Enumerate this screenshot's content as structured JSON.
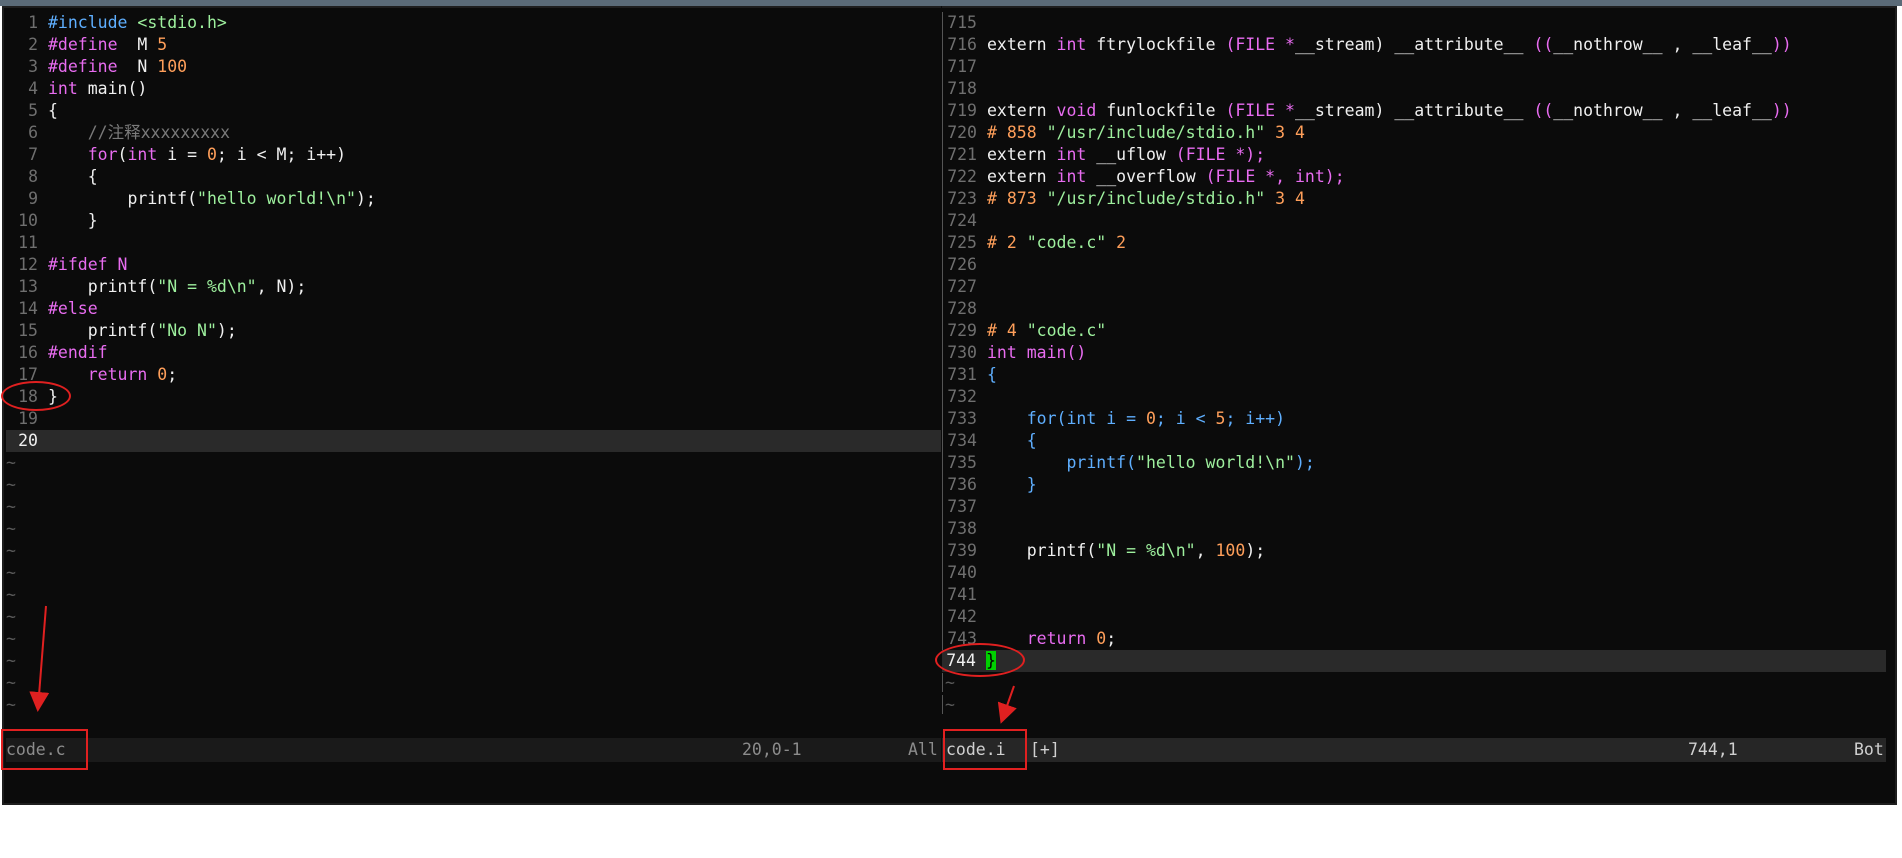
{
  "left_pane": {
    "lines": [
      {
        "n": "1",
        "tokens": [
          [
            "c-pre",
            "#include "
          ],
          [
            "c-str",
            "<stdio.h>"
          ]
        ]
      },
      {
        "n": "2",
        "tokens": [
          [
            "c-def",
            "#define  "
          ],
          [
            "c-ident",
            "M "
          ],
          [
            "c-num",
            "5"
          ]
        ]
      },
      {
        "n": "3",
        "tokens": [
          [
            "c-def",
            "#define  "
          ],
          [
            "c-ident",
            "N "
          ],
          [
            "c-num",
            "100"
          ]
        ]
      },
      {
        "n": "4",
        "tokens": [
          [
            "c-type",
            "int"
          ],
          [
            "c-ident",
            " main()"
          ]
        ]
      },
      {
        "n": "5",
        "tokens": [
          [
            "c-ident",
            "{"
          ]
        ]
      },
      {
        "n": "6",
        "tokens": [
          [
            "c-cmt",
            "    //注释xxxxxxxxx"
          ]
        ]
      },
      {
        "n": "7",
        "tokens": [
          [
            "c-kw",
            "    for"
          ],
          [
            "c-ident",
            "("
          ],
          [
            "c-type",
            "int"
          ],
          [
            "c-ident",
            " i = "
          ],
          [
            "c-num",
            "0"
          ],
          [
            "c-ident",
            "; i < M; i++)"
          ]
        ]
      },
      {
        "n": "8",
        "tokens": [
          [
            "c-ident",
            "    {"
          ]
        ]
      },
      {
        "n": "9",
        "tokens": [
          [
            "c-ident",
            "        printf("
          ],
          [
            "c-str",
            "\"hello world!\\n\""
          ],
          [
            "c-ident",
            ");"
          ]
        ]
      },
      {
        "n": "10",
        "tokens": [
          [
            "c-ident",
            "    }"
          ]
        ]
      },
      {
        "n": "11",
        "tokens": []
      },
      {
        "n": "12",
        "tokens": [
          [
            "c-def",
            "#ifdef N"
          ]
        ]
      },
      {
        "n": "13",
        "tokens": [
          [
            "c-ident",
            "    printf("
          ],
          [
            "c-str",
            "\"N = %d\\n\""
          ],
          [
            "c-ident",
            ", N);"
          ]
        ]
      },
      {
        "n": "14",
        "tokens": [
          [
            "c-def",
            "#else"
          ]
        ]
      },
      {
        "n": "15",
        "tokens": [
          [
            "c-ident",
            "    printf("
          ],
          [
            "c-str",
            "\"No N\""
          ],
          [
            "c-ident",
            ");"
          ]
        ]
      },
      {
        "n": "16",
        "tokens": [
          [
            "c-def",
            "#endif"
          ]
        ]
      },
      {
        "n": "17",
        "tokens": [
          [
            "c-kw",
            "    return "
          ],
          [
            "c-num",
            "0"
          ],
          [
            "c-ident",
            ";"
          ]
        ]
      },
      {
        "n": "18",
        "tokens": [
          [
            "c-ident",
            "}"
          ]
        ]
      },
      {
        "n": "19",
        "tokens": []
      },
      {
        "n": "20",
        "tokens": [],
        "current": true
      }
    ],
    "tilde_count": 12,
    "tilde_char": "~"
  },
  "right_pane": {
    "lines": [
      {
        "n": "715",
        "tokens": []
      },
      {
        "n": "716",
        "tokens": [
          [
            "c-ident",
            "extern "
          ],
          [
            "c-type",
            "int"
          ],
          [
            "c-ident",
            " ftrylockfile "
          ],
          [
            "c-def",
            "(FILE *"
          ],
          [
            "c-ident",
            "__stream) __attribute__ "
          ],
          [
            "c-def",
            "(("
          ],
          [
            "c-ident",
            "__nothrow__ , __leaf__"
          ],
          [
            "c-def",
            "))"
          ]
        ]
      },
      {
        "n": "717",
        "tokens": []
      },
      {
        "n": "718",
        "tokens": []
      },
      {
        "n": "719",
        "tokens": [
          [
            "c-ident",
            "extern "
          ],
          [
            "c-type",
            "void"
          ],
          [
            "c-ident",
            " funlockfile "
          ],
          [
            "c-def",
            "(FILE *"
          ],
          [
            "c-ident",
            "__stream) __attribute__ "
          ],
          [
            "c-def",
            "(("
          ],
          [
            "c-ident",
            "__nothrow__ , __leaf__"
          ],
          [
            "c-def",
            "))"
          ]
        ]
      },
      {
        "n": "720",
        "tokens": [
          [
            "c-num",
            "# 858 "
          ],
          [
            "c-str",
            "\"/usr/include/stdio.h\""
          ],
          [
            "c-num",
            " 3 4"
          ]
        ]
      },
      {
        "n": "721",
        "tokens": [
          [
            "c-ident",
            "extern "
          ],
          [
            "c-type",
            "int"
          ],
          [
            "c-ident",
            " __uflow "
          ],
          [
            "c-def",
            "(FILE *);"
          ]
        ]
      },
      {
        "n": "722",
        "tokens": [
          [
            "c-ident",
            "extern "
          ],
          [
            "c-type",
            "int"
          ],
          [
            "c-ident",
            " __overflow "
          ],
          [
            "c-def",
            "(FILE *, "
          ],
          [
            "c-type",
            "int"
          ],
          [
            "c-def",
            ");"
          ]
        ]
      },
      {
        "n": "723",
        "tokens": [
          [
            "c-num",
            "# 873 "
          ],
          [
            "c-str",
            "\"/usr/include/stdio.h\""
          ],
          [
            "c-num",
            " 3 4"
          ]
        ]
      },
      {
        "n": "724",
        "tokens": []
      },
      {
        "n": "725",
        "tokens": [
          [
            "c-num",
            "# 2 "
          ],
          [
            "c-str",
            "\"code.c\""
          ],
          [
            "c-num",
            " 2"
          ]
        ]
      },
      {
        "n": "726",
        "tokens": []
      },
      {
        "n": "727",
        "tokens": []
      },
      {
        "n": "728",
        "tokens": []
      },
      {
        "n": "729",
        "tokens": [
          [
            "c-num",
            "# 4 "
          ],
          [
            "c-str",
            "\"code.c\""
          ]
        ]
      },
      {
        "n": "730",
        "tokens": [
          [
            "c-type",
            "int"
          ],
          [
            "c-kw",
            " main()"
          ]
        ]
      },
      {
        "n": "731",
        "tokens": [
          [
            "c-brk",
            "{"
          ]
        ]
      },
      {
        "n": "732",
        "tokens": []
      },
      {
        "n": "733",
        "tokens": [
          [
            "c-brk",
            "    for(int i = "
          ],
          [
            "c-num",
            "0"
          ],
          [
            "c-brk",
            "; i < "
          ],
          [
            "c-num",
            "5"
          ],
          [
            "c-brk",
            "; i++)"
          ]
        ]
      },
      {
        "n": "734",
        "tokens": [
          [
            "c-brk",
            "    {"
          ]
        ]
      },
      {
        "n": "735",
        "tokens": [
          [
            "c-brk",
            "        printf("
          ],
          [
            "c-str",
            "\"hello world!\\n\""
          ],
          [
            "c-brk",
            ");"
          ]
        ]
      },
      {
        "n": "736",
        "tokens": [
          [
            "c-brk",
            "    }"
          ]
        ]
      },
      {
        "n": "737",
        "tokens": []
      },
      {
        "n": "738",
        "tokens": []
      },
      {
        "n": "739",
        "tokens": [
          [
            "c-ident",
            "    printf("
          ],
          [
            "c-str",
            "\"N = %d\\n\""
          ],
          [
            "c-ident",
            ", "
          ],
          [
            "c-num",
            "100"
          ],
          [
            "c-ident",
            ");"
          ]
        ]
      },
      {
        "n": "740",
        "tokens": []
      },
      {
        "n": "741",
        "tokens": []
      },
      {
        "n": "742",
        "tokens": []
      },
      {
        "n": "743",
        "tokens": [
          [
            "c-kw",
            "    return "
          ],
          [
            "c-num",
            "0"
          ],
          [
            "c-ident",
            ";"
          ]
        ]
      },
      {
        "n": "744",
        "tokens": [
          [
            "c-cur",
            "}"
          ]
        ],
        "current": true
      }
    ],
    "tilde_count": 2,
    "tilde_char": "~"
  },
  "status_left": {
    "filename": "code.c",
    "position": "20,0-1",
    "scroll": "All"
  },
  "status_right": {
    "filename": "code.i",
    "modified": "[+]",
    "position": "744,1",
    "scroll": "Bot"
  },
  "colors": {
    "annotation": "#e02020",
    "cursor": "#00d000",
    "background": "#0b0b0b"
  }
}
